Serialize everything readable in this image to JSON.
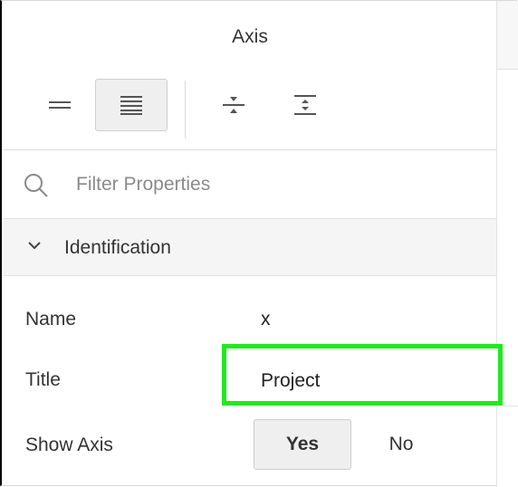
{
  "panel": {
    "title": "Axis"
  },
  "toolbar": {
    "buttons": [
      {
        "name": "collapsed-view",
        "icon": "two-lines-icon",
        "active": false
      },
      {
        "name": "expanded-view",
        "icon": "multi-lines-icon",
        "active": true
      },
      {
        "name": "collapse-all",
        "icon": "collapse-all-icon",
        "active": false
      },
      {
        "name": "expand-all",
        "icon": "expand-all-icon",
        "active": false
      }
    ]
  },
  "filter": {
    "placeholder": "Filter Properties",
    "icon": "search-icon"
  },
  "section": {
    "label": "Identification",
    "icon": "chevron-down-icon"
  },
  "properties": {
    "name": {
      "label": "Name",
      "value": "x"
    },
    "title": {
      "label": "Title",
      "value": "Project"
    },
    "show_axis": {
      "label": "Show Axis",
      "yes": "Yes",
      "no": "No",
      "selected": "Yes"
    }
  },
  "colors": {
    "highlight": "#22e822"
  }
}
